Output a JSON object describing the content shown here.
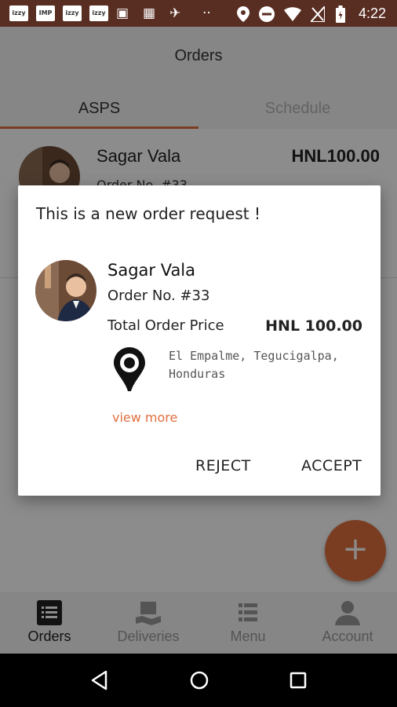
{
  "status_bar": {
    "apps": [
      "izzy",
      "IMP",
      "izzy",
      "izzy"
    ],
    "time": "4:22",
    "icons": [
      "photo-icon",
      "calendar-icon",
      "satellite-icon",
      "more-dots-icon",
      "location-icon",
      "do-not-disturb-icon",
      "wifi-icon",
      "no-signal-icon",
      "battery-icon"
    ]
  },
  "app_bar": {
    "title": "Orders"
  },
  "tabs": {
    "active": "ASPS",
    "inactive": "Schedule"
  },
  "list": {
    "items": [
      {
        "name": "Sagar Vala",
        "price": "HNL100.00",
        "order": "Order No. #33"
      }
    ]
  },
  "dialog": {
    "title": "This is a new order request !",
    "name": "Sagar Vala",
    "order": "Order No. #33",
    "total_label": "Total Order Price",
    "total_value": "HNL 100.00",
    "address": "El Empalme, Tegucigalpa, Honduras",
    "view_more": "view more",
    "reject": "REJECT",
    "accept": "ACCEPT"
  },
  "fab": {
    "label": "+"
  },
  "bottom_nav": {
    "items": [
      {
        "label": "Orders"
      },
      {
        "label": "Deliveries"
      },
      {
        "label": "Menu"
      },
      {
        "label": "Account"
      }
    ]
  },
  "colors": {
    "accent": "#e0703f",
    "status_bar": "#582d22"
  }
}
